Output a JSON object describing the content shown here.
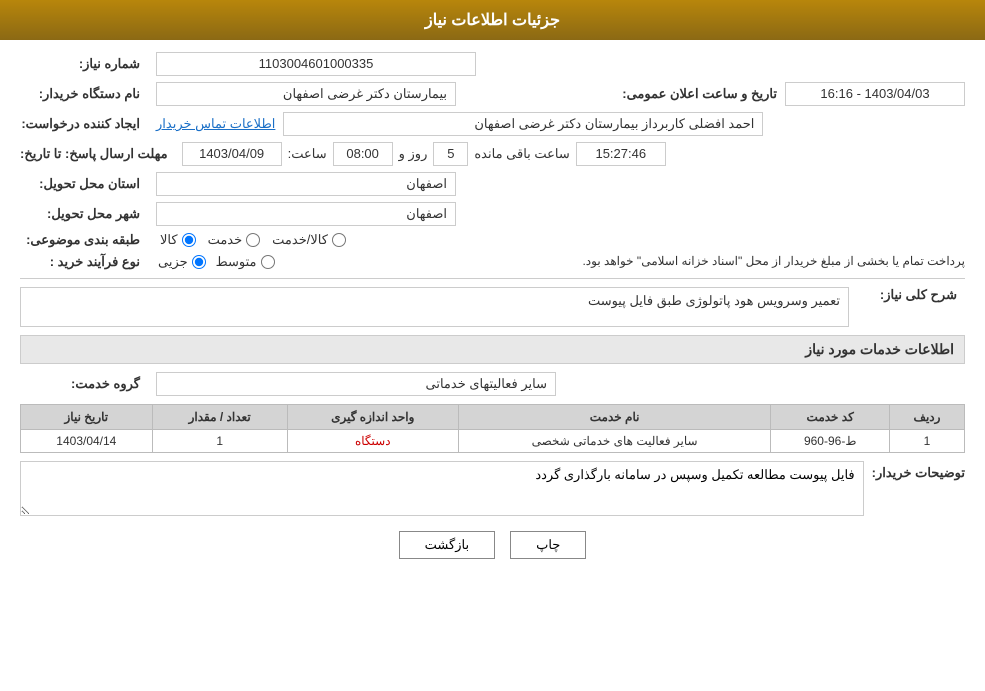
{
  "page": {
    "title": "جزئیات اطلاعات نیاز",
    "header": {
      "label": "جزئیات اطلاعات نیاز"
    }
  },
  "fields": {
    "shomara_niaz_label": "شماره نیاز:",
    "shomara_niaz_value": "1103004601000335",
    "nam_dastgah_label": "نام دستگاه خریدار:",
    "nam_dastgah_value": "بیمارستان دکتر غرضی اصفهان",
    "ijad_konande_label": "ایجاد کننده درخواست:",
    "ijad_konande_value": "احمد افضلی کاربرداز بیمارستان دکتر غرضی اصفهان",
    "etelaat_tamas_label": "اطلاعات تماس خریدار",
    "mohlat_label": "مهلت ارسال پاسخ: تا تاریخ:",
    "tarikh_value": "1403/04/09",
    "saat_label": "ساعت:",
    "saat_value": "08:00",
    "roz_label": "روز و",
    "roz_value": "5",
    "saat_mande_label": "ساعت باقی مانده",
    "saat_mande_value": "15:27:46",
    "tarikh_aalan_label": "تاریخ و ساعت اعلان عمومی:",
    "tarikh_aalan_value": "1403/04/03 - 16:16",
    "ostan_label": "استان محل تحویل:",
    "ostan_value": "اصفهان",
    "shahr_label": "شهر محل تحویل:",
    "shahr_value": "اصفهان",
    "tabaqe_label": "طبقه بندی موضوعی:",
    "tabaqe_kala": "کالا",
    "tabaqe_khedmat": "خدمت",
    "tabaqe_kala_khedmat": "کالا/خدمت",
    "nooe_farayand_label": "نوع فرآیند خرید :",
    "jozi": "جزیی",
    "motevaset": "متوسط",
    "payment_notice": "پرداخت تمام یا بخشی از مبلغ خریدار از محل \"اسناد خزانه اسلامی\" خواهد بود.",
    "sharh_label": "شرح کلی نیاز:",
    "sharh_value": "تعمیر وسرویس هود پاتولوژی طبق فایل پیوست",
    "khadamat_title": "اطلاعات خدمات مورد نیاز",
    "grooh_khedmat_label": "گروه خدمت:",
    "grooh_khedmat_value": "سایر فعالیتهای خدماتی",
    "table": {
      "headers": [
        "ردیف",
        "کد خدمت",
        "نام خدمت",
        "واحد اندازه گیری",
        "تعداد / مقدار",
        "تاریخ نیاز"
      ],
      "rows": [
        {
          "radif": "1",
          "code": "ط-96-960",
          "name": "سایر فعالیت های خدماتی شخصی",
          "vahed": "دستگاه",
          "tedad": "1",
          "tarikh": "1403/04/14"
        }
      ]
    },
    "tozihat_label": "توضیحات خریدار:",
    "tozihat_value": "فایل پیوست مطالعه تکمیل وسپس در سامانه بارگذاری گردد",
    "btn_print": "چاپ",
    "btn_back": "بازگشت"
  }
}
